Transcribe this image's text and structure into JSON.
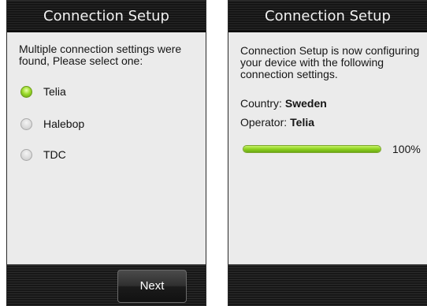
{
  "left_screen": {
    "title": "Connection Setup",
    "prompt": "Multiple connection settings were found, Please select one:",
    "options": [
      {
        "label": "Telia",
        "selected": true
      },
      {
        "label": "Halebop",
        "selected": false
      },
      {
        "label": "TDC",
        "selected": false
      }
    ],
    "next_label": "Next"
  },
  "right_screen": {
    "title": "Connection Setup",
    "message": "Connection Setup is now configuring your device with the following connection settings.",
    "country_label": "Country:",
    "country_value": "Sweden",
    "operator_label": "Operator:",
    "operator_value": "Telia",
    "progress_percent": 100,
    "progress_text": "100%"
  },
  "colors": {
    "accent_green": "#8fd21f",
    "content_bg": "#ebebeb",
    "bar_bg": "#151515"
  }
}
